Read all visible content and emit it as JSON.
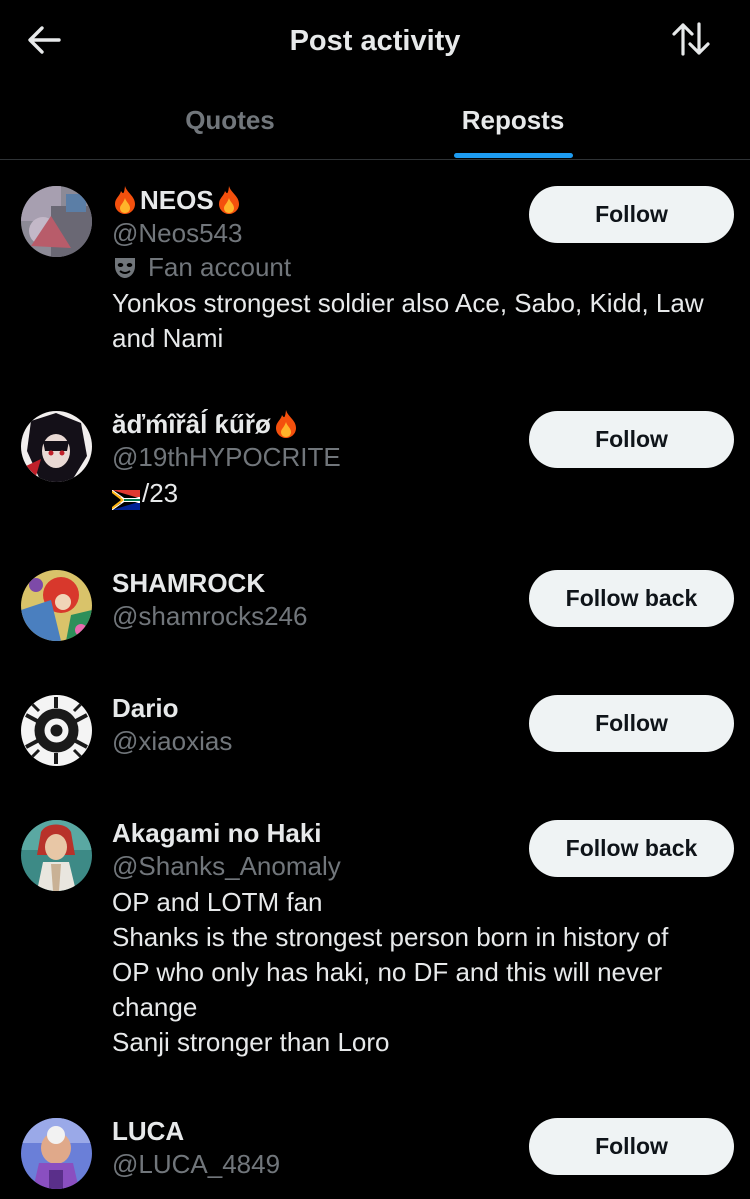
{
  "header": {
    "title": "Post activity",
    "back_icon": "arrow-left-icon",
    "sort_icon": "sort-arrows-icon"
  },
  "tabs": [
    {
      "label": "Quotes",
      "active": false
    },
    {
      "label": "Reposts",
      "active": true
    }
  ],
  "colors": {
    "background": "#000000",
    "text_primary": "#e7e9ea",
    "text_secondary": "#71767b",
    "accent": "#1d9bf0",
    "button_bg": "#eff3f4",
    "button_text": "#0f1419",
    "divider": "#2f3336"
  },
  "users": [
    {
      "display_name": "NEOS",
      "name_prefix_icon": "fire-emoji-icon",
      "name_suffix_icon": "fire-emoji-icon",
      "handle": "@Neos543",
      "label": "Fan account",
      "label_icon": "mask-icon",
      "bio": [
        "Yonkos strongest soldier also Ace, Sabo, Kidd, Law",
        "and Nami"
      ],
      "button": "Follow"
    },
    {
      "display_name": "ăďḿîřâĺ ƙűřø",
      "name_suffix_icon": "fire-emoji-icon",
      "handle": "@19thHYPOCRITE",
      "bio_flag_icon": "south-africa-flag-icon",
      "bio": [
        "/23"
      ],
      "button": "Follow"
    },
    {
      "display_name": "SHAMROCK",
      "handle": "@shamrocks246",
      "button": "Follow back"
    },
    {
      "display_name": "Dario",
      "handle": "@xiaoxias",
      "button": "Follow"
    },
    {
      "display_name": "Akagami no Haki",
      "handle": "@Shanks_Anomaly",
      "bio": [
        "OP and LOTM fan",
        "Shanks is the strongest person born in history of",
        "OP who only has haki, no DF and this will never",
        "change",
        "Sanji stronger than Loro"
      ],
      "button": "Follow back"
    },
    {
      "display_name": "LUCA",
      "handle": "@LUCA_4849",
      "button": "Follow"
    }
  ]
}
